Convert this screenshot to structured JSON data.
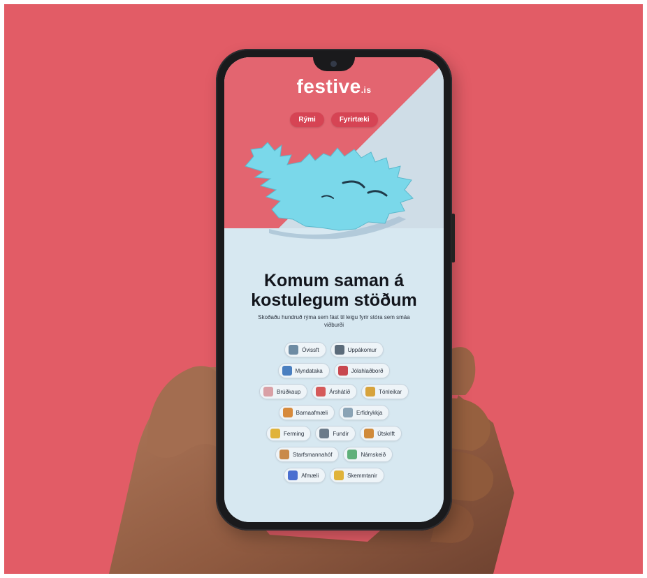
{
  "app": {
    "logo": "festive",
    "logo_tld": ".is"
  },
  "nav": {
    "buttons": [
      "Rými",
      "Fyrirtæki"
    ]
  },
  "hero": {
    "headline_line1": "Komum saman á",
    "headline_line2": "kostulegum stöðum",
    "subtitle": "Skoðaðu hundruð rýma sem fást til leigu fyrir stóra sem smáa viðburði"
  },
  "categories": [
    [
      {
        "label": "Óvissft",
        "icon": "eye-icon",
        "color": "#6d8ba3"
      },
      {
        "label": "Uppákomur",
        "icon": "gear-icon",
        "color": "#5b6b7a"
      }
    ],
    [
      {
        "label": "Myndataka",
        "icon": "camera-icon",
        "color": "#4a7fc0"
      },
      {
        "label": "Jólahlaðborð",
        "icon": "gift-icon",
        "color": "#c8474f"
      }
    ],
    [
      {
        "label": "Brúðkaup",
        "icon": "rings-icon",
        "color": "#d9a0a6"
      },
      {
        "label": "Árshátíð",
        "icon": "party-icon",
        "color": "#d55a5a"
      },
      {
        "label": "Tónleikar",
        "icon": "mic-icon",
        "color": "#d7a33c"
      }
    ],
    [
      {
        "label": "Barnaafmæli",
        "icon": "cake-icon",
        "color": "#d78a3c"
      },
      {
        "label": "Erfidrykkja",
        "icon": "person-icon",
        "color": "#8aa3b5"
      }
    ],
    [
      {
        "label": "Ferming",
        "icon": "candle-icon",
        "color": "#e0b33a"
      },
      {
        "label": "Fundir",
        "icon": "settings-icon",
        "color": "#6b7b8a"
      },
      {
        "label": "Útskrift",
        "icon": "cap-icon",
        "color": "#d08a3a"
      }
    ],
    [
      {
        "label": "Starfsmannahóf",
        "icon": "people-icon",
        "color": "#c98a4a"
      },
      {
        "label": "Námskeið",
        "icon": "book-icon",
        "color": "#5fb07a"
      }
    ],
    [
      {
        "label": "Afmæli",
        "icon": "balloon-icon",
        "color": "#4a6fd0"
      },
      {
        "label": "Skemmtanir",
        "icon": "star-icon",
        "color": "#e0b33a"
      }
    ]
  ]
}
